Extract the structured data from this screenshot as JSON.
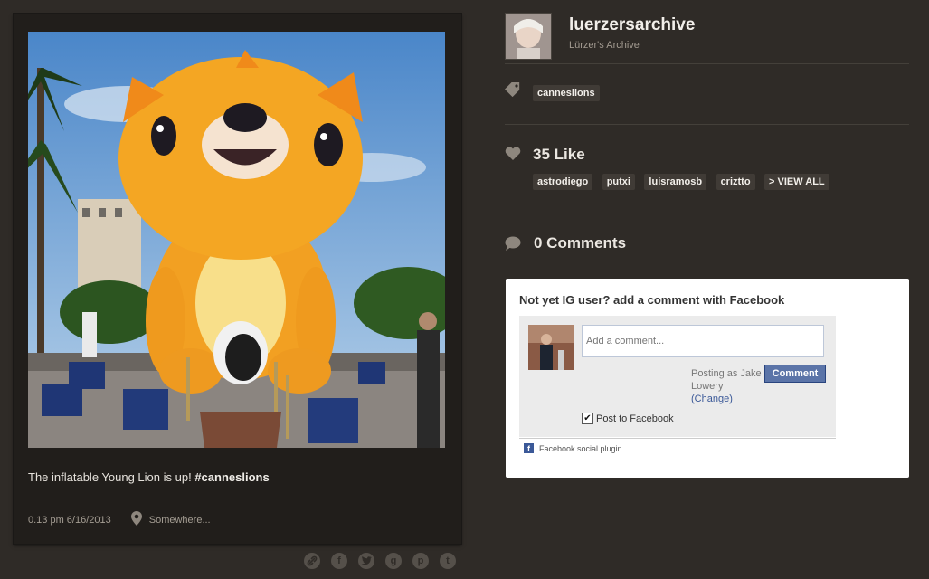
{
  "post": {
    "caption_text": "The inflatable Young Lion is up! ",
    "caption_tag": "#canneslions",
    "timestamp": "0.13 pm 6/16/2013",
    "location": "Somewhere..."
  },
  "share_icons": [
    "link-icon",
    "facebook-icon",
    "twitter-icon",
    "google-plus-icon",
    "pinterest-icon",
    "tumblr-icon"
  ],
  "profile": {
    "username": "luerzersarchive",
    "full_name": "Lürzer's Archive"
  },
  "tags": [
    "canneslions"
  ],
  "likes": {
    "title": "35 Like",
    "users": [
      "astrodiego",
      "putxi",
      "luisramosb",
      "criztto"
    ],
    "view_all": "> VIEW ALL"
  },
  "comments": {
    "title": "0 Comments"
  },
  "facebook": {
    "heading": "Not yet IG user? add a comment with Facebook",
    "input_placeholder": "Add a comment...",
    "posting_as": "Posting as Jake Lowery",
    "change_link": "(Change)",
    "comment_button": "Comment",
    "post_to_label": "Post to Facebook",
    "post_to_checked": true,
    "plugin_label": "Facebook social plugin",
    "brand_color": "#3b5998"
  }
}
